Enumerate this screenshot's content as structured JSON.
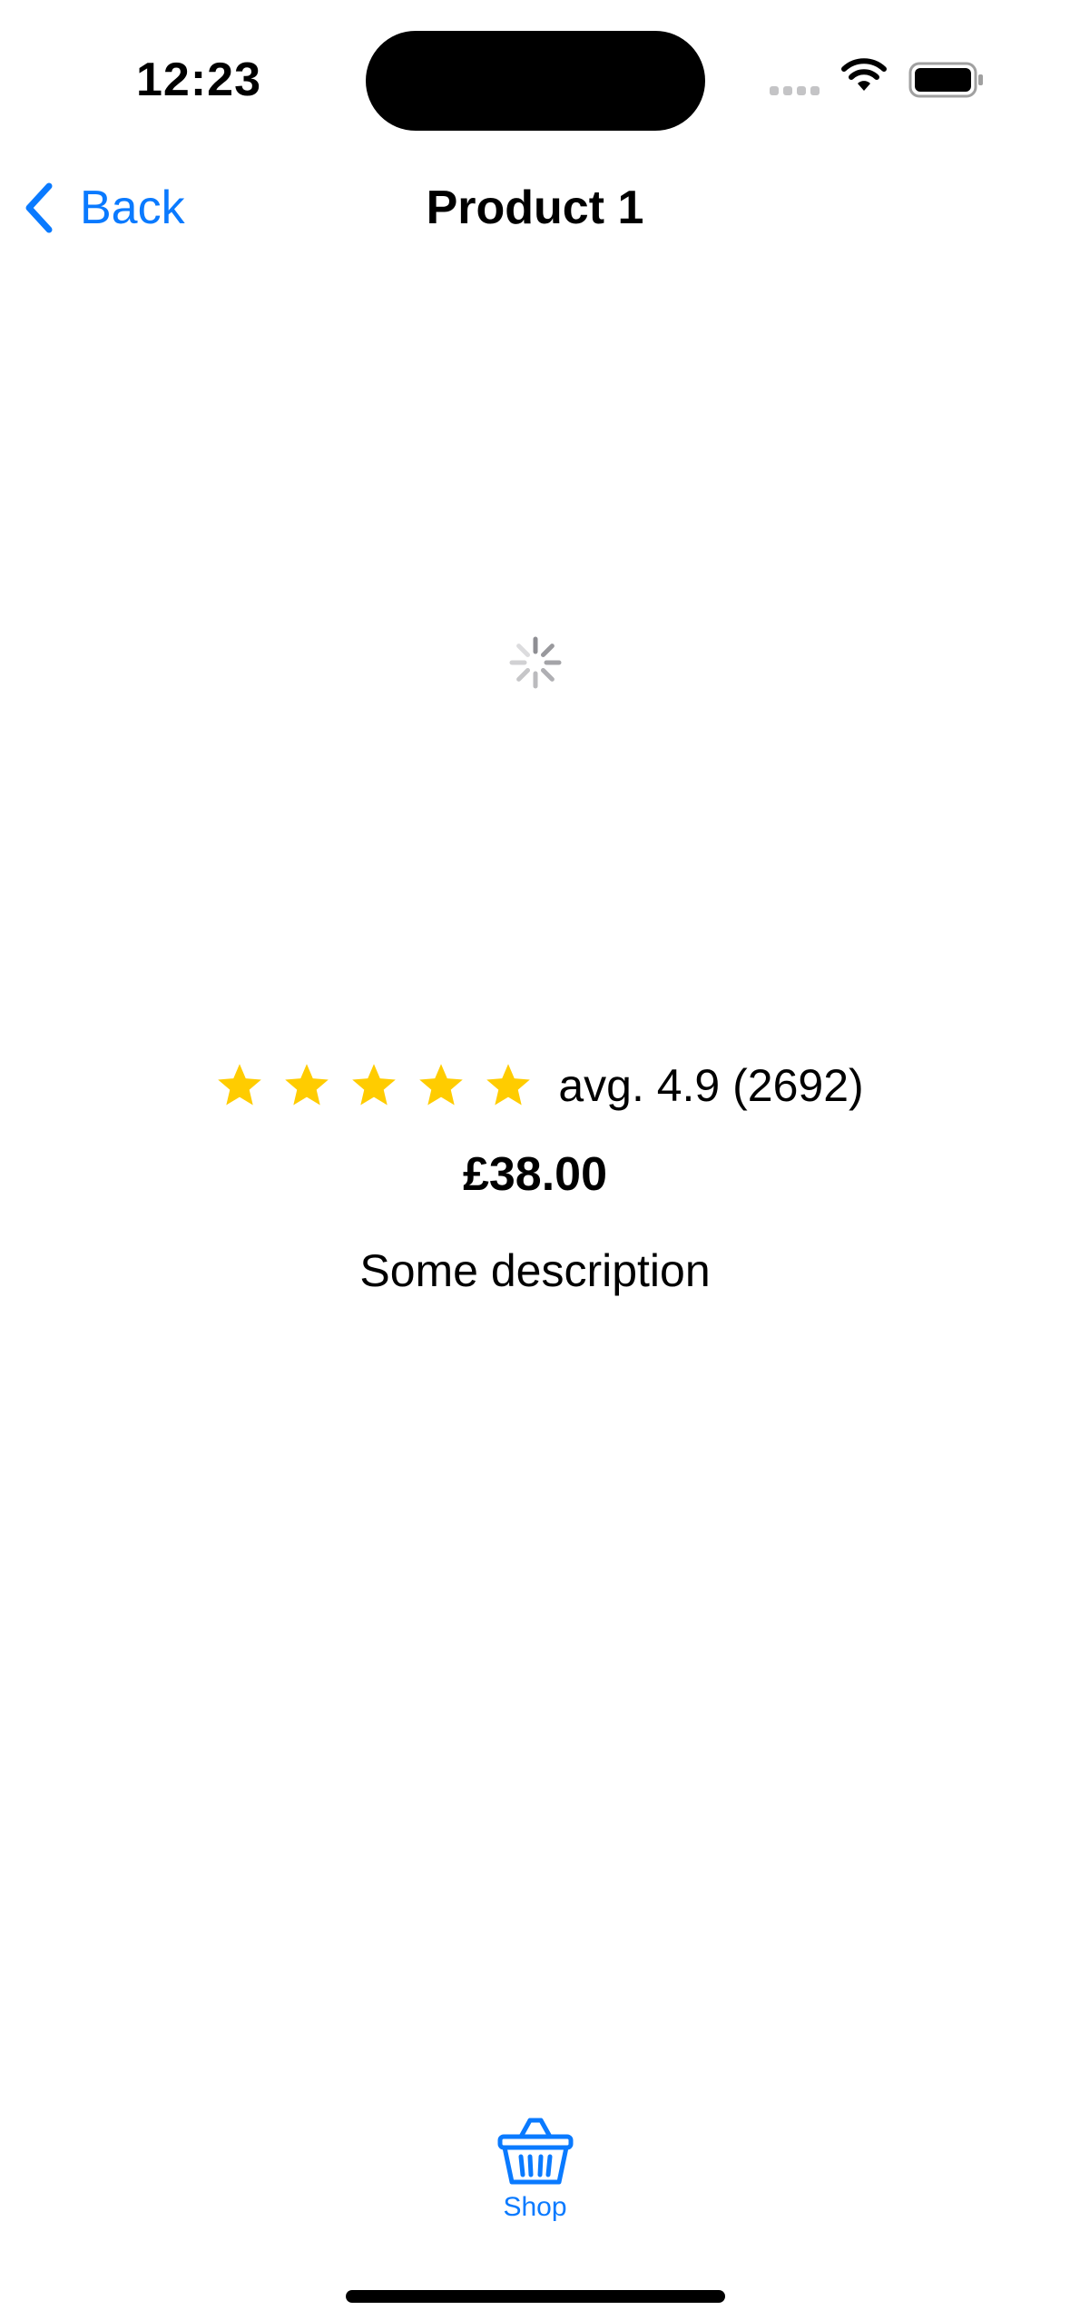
{
  "status_bar": {
    "time": "12:23"
  },
  "nav": {
    "back_label": "Back",
    "title": "Product 1"
  },
  "product": {
    "rating_stars": 5,
    "rating_text": "avg. 4.9 (2692)",
    "price": "£38.00",
    "description": "Some description"
  },
  "tab_bar": {
    "shop_label": "Shop"
  },
  "icons": {
    "back": "chevron-left-icon",
    "star": "star-icon",
    "tab_shop": "basket-icon",
    "loading": "activity-spinner-icon"
  },
  "colors": {
    "accent": "#0a7aff",
    "star": "#ffcc00",
    "spinner": "#8e8e93"
  }
}
